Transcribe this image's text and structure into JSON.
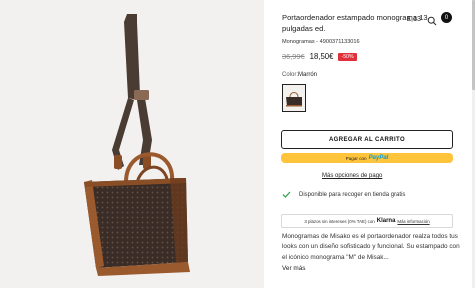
{
  "product": {
    "title": "Portaordenador estampado monograma 13 pulgadas ed.",
    "subtitle": "Monogramas - 4900371133016",
    "old_price": "36,99€",
    "new_price": "18,50€",
    "discount": "-50%",
    "color_label": "Color:",
    "color_value": "Marrón",
    "image_name": "monogram-laptop-bag"
  },
  "header": {
    "price_top": "£,13",
    "bag_count": "0",
    "icons": [
      "search-icon",
      "bag-icon"
    ]
  },
  "actions": {
    "add_to_cart": "AGREGAR AL CARRITO",
    "paypal_prefix": "Pagar con",
    "paypal_brand_a": "Pay",
    "paypal_brand_b": "Pal",
    "more_payment": "Más opciones de pago",
    "pickup": "Disponible para recoger en tienda gratis"
  },
  "klarna": {
    "text": "3 plazos sin intereses (0% TAE) con",
    "brand": "Klarna",
    "link": "Más información"
  },
  "description": {
    "text": "Monogramas de Misako es el portaordenador realza todos tus looks con un diseño sofisticado y funcional. Su estampado con el icónico monograma \"M\" de Misak...",
    "see_more": "Ver más"
  },
  "colors": {
    "bag_dark": "#3a2c26",
    "bag_trim": "#9a5a2e",
    "paypal_yellow": "#ffc439",
    "discount_red": "#e0303a",
    "pickup_check": "#2e9d4a"
  }
}
